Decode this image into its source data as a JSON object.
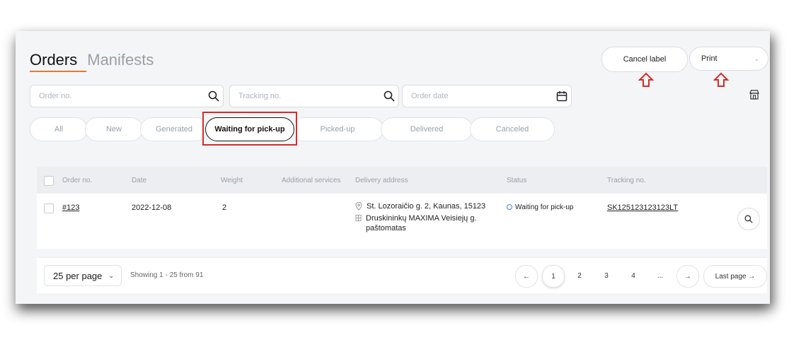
{
  "tabs": [
    {
      "label": "Orders",
      "active": true
    },
    {
      "label": "Manifests",
      "active": false
    }
  ],
  "actions": {
    "cancel_label": "Cancel label",
    "print_label": "Print"
  },
  "filters": {
    "order_no_placeholder": "Order no.",
    "tracking_no_placeholder": "Tracking no.",
    "order_date_placeholder": "Order date"
  },
  "status_chips": [
    {
      "label": "All",
      "active": false
    },
    {
      "label": "New",
      "active": false
    },
    {
      "label": "Generated",
      "active": false
    },
    {
      "label": "Waiting for pick-up",
      "active": true
    },
    {
      "label": "Picked-up",
      "active": false
    },
    {
      "label": "Delivered",
      "active": false
    },
    {
      "label": "Canceled",
      "active": false
    }
  ],
  "table": {
    "headers": {
      "order_no": "Order no.",
      "date": "Date",
      "weight": "Weight",
      "additional_services": "Additional services",
      "delivery_address": "Delivery address",
      "status": "Status",
      "tracking_no": "Tracking no."
    },
    "rows": [
      {
        "order_no": "#123",
        "date": "2022-12-08",
        "weight": "2",
        "address_from": "St. Lozoraičio g. 2, Kaunas, 15123",
        "address_to": "Druskininkų MAXIMA Veisiejų g. paštomatas",
        "status": "Waiting for pick-up",
        "tracking_no": "SK125123123123LT"
      }
    ]
  },
  "footer": {
    "per_page": "25 per page",
    "showing": "Showing 1 - 25 from 91",
    "pages": [
      "1",
      "2",
      "3",
      "4",
      "..."
    ],
    "current_page": "1",
    "last_page": "Last page →",
    "prev": "←",
    "next": "→"
  },
  "colors": {
    "accent_underline": "#e07b39",
    "highlight_red": "#d62b2b",
    "status_blue": "#4a7fe0"
  }
}
